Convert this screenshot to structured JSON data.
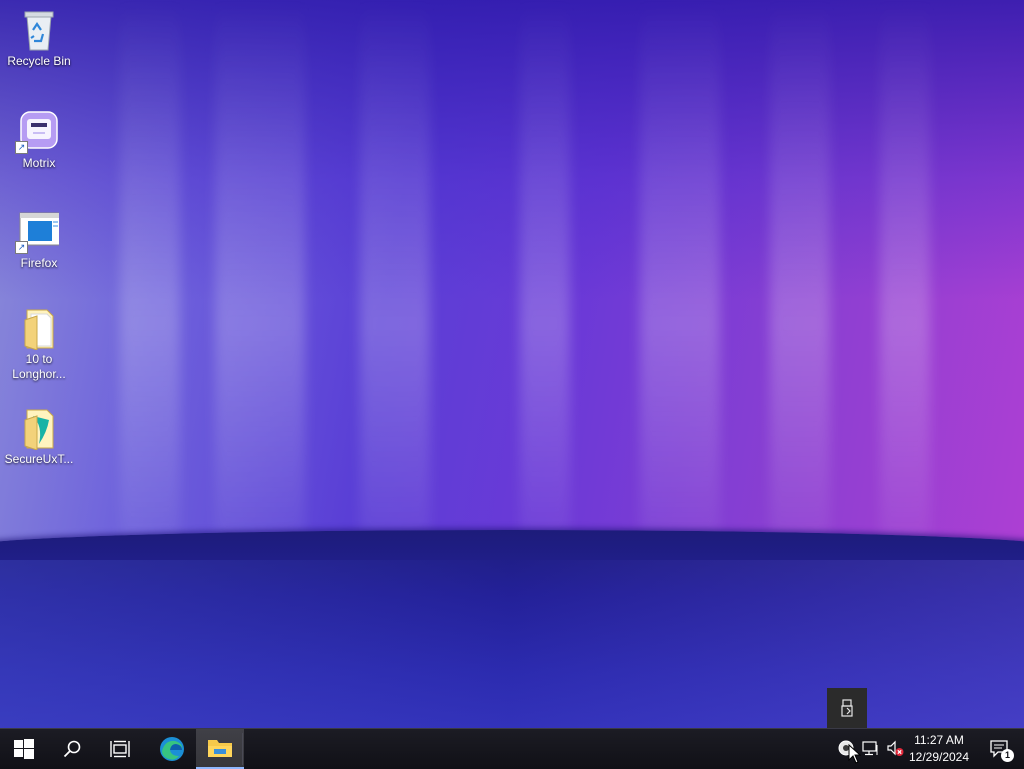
{
  "desktop": {
    "icons": [
      {
        "label": "Recycle Bin",
        "icon": "recycle-bin-icon"
      },
      {
        "label": "Motrix",
        "icon": "motrix-app-icon"
      },
      {
        "label": "Firefox",
        "icon": "firefox-shortcut-icon"
      },
      {
        "label": "10 to\nLonghor...",
        "icon": "folder-icon"
      },
      {
        "label": "SecureUxT...",
        "icon": "secureux-folder-icon"
      }
    ]
  },
  "taskbar": {
    "start": {
      "icon": "windows-logo-icon"
    },
    "search": {
      "icon": "search-icon"
    },
    "task_view": {
      "icon": "task-view-icon"
    },
    "pinned": [
      {
        "name": "Microsoft Edge",
        "icon": "edge-icon"
      },
      {
        "name": "File Explorer",
        "icon": "file-explorer-icon",
        "active": true
      }
    ],
    "tray": {
      "icons": [
        "usb-safely-remove-icon",
        "network-icon",
        "volume-muted-icon"
      ],
      "time": "11:27 AM",
      "date": "12/29/2024",
      "notification_count": "1"
    }
  },
  "colors": {
    "taskbar_bg": "#101016",
    "accent": "#8fb8ff",
    "wallpaper_purple": "#6b39d7",
    "wallpaper_magenta": "#b13fd3",
    "wallpaper_ground": "#232098"
  }
}
